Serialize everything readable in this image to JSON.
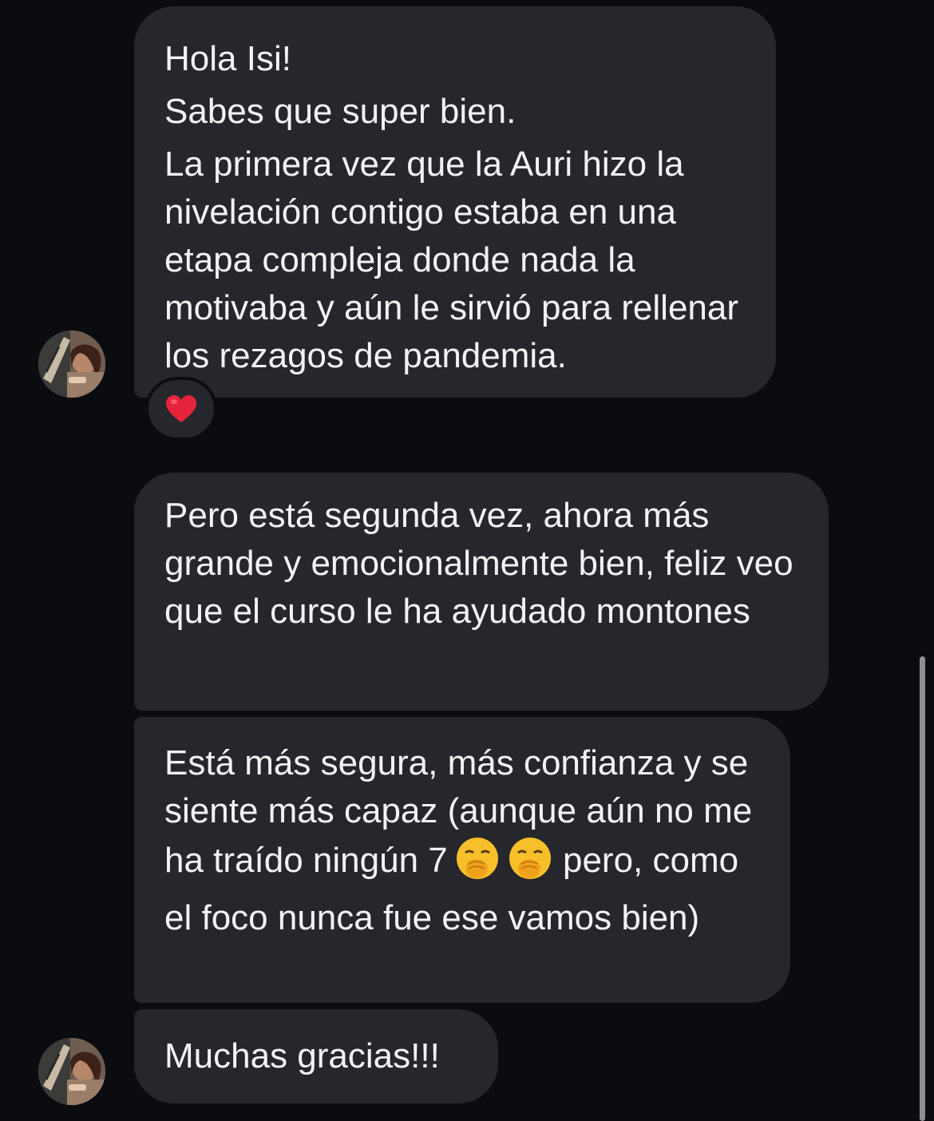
{
  "messages": [
    {
      "lines": [
        "Hola Isi!",
        "Sabes que super bien.",
        "La primera vez que la Auri hizo la nivelación contigo estaba en una etapa compleja donde nada la motivaba y aún le sirvió para rellenar los rezagos de pandemia."
      ],
      "reaction": "❤️"
    },
    {
      "text": "Pero está segunda vez, ahora más grande y emocionalmente bien, feliz veo que el curso le ha ayudado montones"
    },
    {
      "text_before_emoji": "Está más segura, más confianza y se siente más capaz (aunque aún no me ha traído ningún 7",
      "emoji": "hand-over-mouth-emoji",
      "text_after_emoji": "pero, como el foco nunca fue ese vamos bien)"
    },
    {
      "text": "Muchas gracias!!!"
    }
  ],
  "icons": {
    "reaction": "red-heart-icon",
    "avatar": "contact-avatar"
  },
  "colors": {
    "background": "#0b0c10",
    "bubble": "#26272c",
    "text": "#f2f3f5",
    "heart": "#e5243b",
    "emoji": "#f7c02a"
  }
}
